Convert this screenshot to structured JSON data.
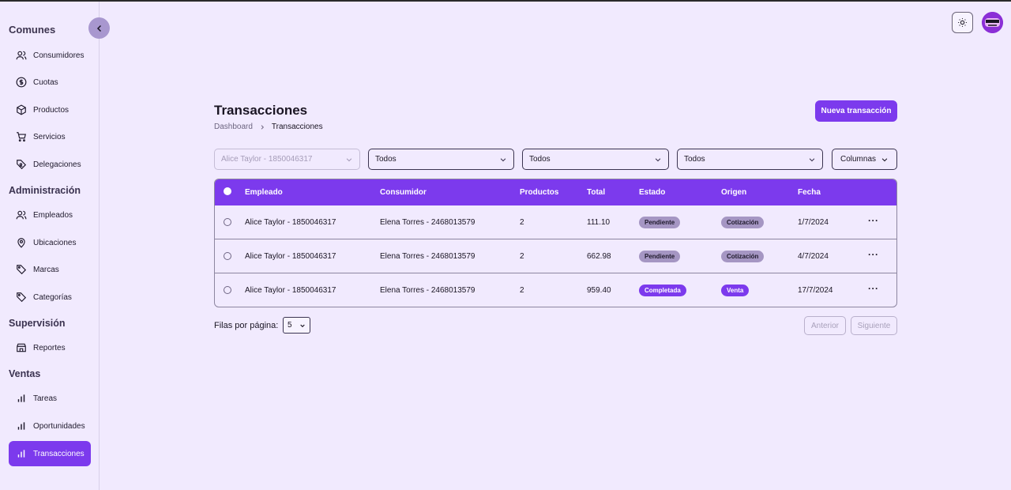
{
  "sidebar": {
    "clipped_heading": "Comunes",
    "groups": [
      {
        "heading": null,
        "items": [
          {
            "label": "Consumidores",
            "icon": "users-icon"
          },
          {
            "label": "Cuotas",
            "icon": "dollar-circle-icon"
          },
          {
            "label": "Productos",
            "icon": "package-icon"
          },
          {
            "label": "Servicios",
            "icon": "cart-icon"
          },
          {
            "label": "Delegaciones",
            "icon": "tag-user-icon"
          }
        ]
      },
      {
        "heading": "Administración",
        "items": [
          {
            "label": "Empleados",
            "icon": "users-icon"
          },
          {
            "label": "Ubicaciones",
            "icon": "map-pin-icon"
          },
          {
            "label": "Marcas",
            "icon": "tag-icon"
          },
          {
            "label": "Categorías",
            "icon": "tag-icon"
          }
        ]
      },
      {
        "heading": "Supervisión",
        "items": [
          {
            "label": "Reportes",
            "icon": "store-icon"
          }
        ]
      },
      {
        "heading": "Ventas",
        "items": [
          {
            "label": "Tareas",
            "icon": "bar-chart-icon"
          },
          {
            "label": "Oportunidades",
            "icon": "bar-chart-icon"
          },
          {
            "label": "Transacciones",
            "icon": "bar-chart-icon",
            "active": true
          }
        ]
      }
    ]
  },
  "header": {
    "title": "Transacciones",
    "breadcrumb": [
      "Dashboard",
      "Transacciones"
    ],
    "new_button": "Nueva transacción"
  },
  "filters": {
    "employee": "Alice Taylor - 1850046317",
    "f1": "Todos",
    "f2": "Todos",
    "f3": "Todos",
    "columns": "Columnas"
  },
  "table": {
    "headers": [
      "Empleado",
      "Consumidor",
      "Productos",
      "Total",
      "Estado",
      "Origen",
      "Fecha"
    ],
    "rows": [
      {
        "empleado": "Alice Taylor - 1850046317",
        "consumidor": "Elena Torres - 2468013579",
        "productos": "2",
        "total": "111.10",
        "estado": "Pendiente",
        "origen": "Cotización",
        "fecha": "1/7/2024"
      },
      {
        "empleado": "Alice Taylor - 1850046317",
        "consumidor": "Elena Torres - 2468013579",
        "productos": "2",
        "total": "662.98",
        "estado": "Pendiente",
        "origen": "Cotización",
        "fecha": "4/7/2024"
      },
      {
        "empleado": "Alice Taylor - 1850046317",
        "consumidor": "Elena Torres - 2468013579",
        "productos": "2",
        "total": "959.40",
        "estado": "Completada",
        "origen": "Venta",
        "fecha": "17/7/2024"
      }
    ],
    "row_menu": "···"
  },
  "pagination": {
    "rows_per_page_label": "Filas por página:",
    "rows_per_page": "5",
    "prev": "Anterior",
    "next": "Siguiente"
  },
  "colors": {
    "accent": "#7c3aed",
    "background": "#f1eafe",
    "badge_muted": "#a596c3"
  }
}
